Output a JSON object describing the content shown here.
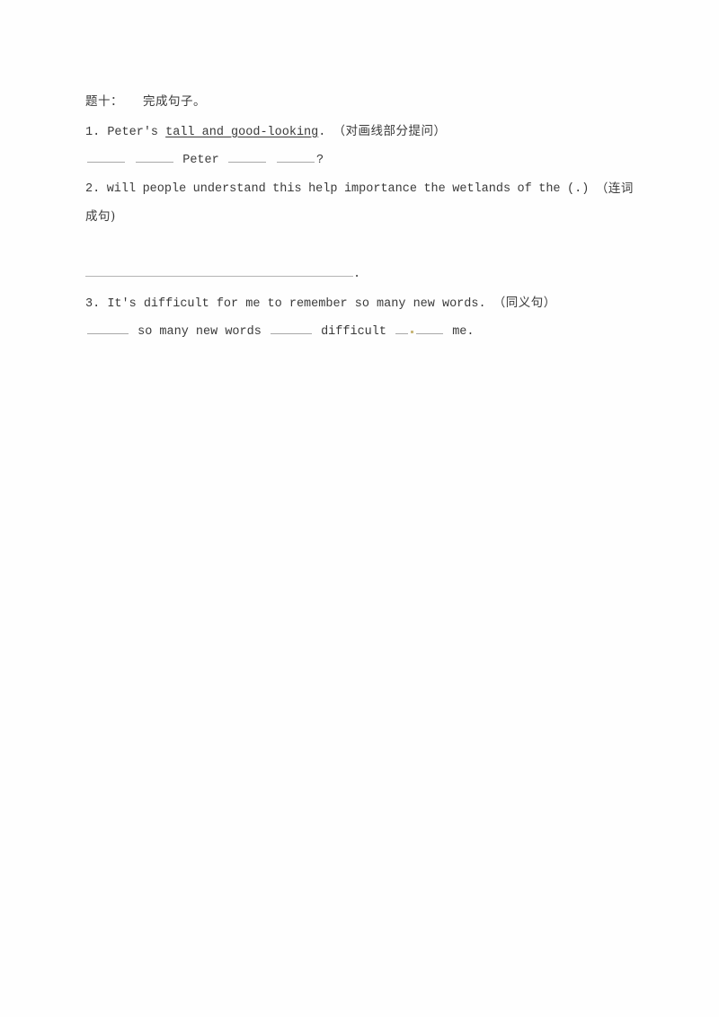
{
  "document": {
    "section_title": {
      "number_label": "题十：",
      "title_text": "完成句子。"
    },
    "questions": [
      {
        "index": "1.",
        "prefix": "Peter's ",
        "underlined": "tall and good-looking",
        "suffix": ".",
        "annotation": "（对画线部分提问）",
        "answer": {
          "middle_word": "Peter",
          "end_mark": "?"
        }
      },
      {
        "index": "2.",
        "scrambled_words": [
          "will",
          "people",
          "understand",
          "this",
          "help",
          "importance",
          "the",
          "wetlands",
          "of",
          "the",
          "(.)",
          "（连词"
        ],
        "annotation_continued": "成句)",
        "answer": {
          "end_mark": "."
        }
      },
      {
        "index": "3.",
        "sentence": "It's difficult for me to remember so many new words.",
        "annotation": "（同义句）",
        "answer": {
          "segment_1": "so many new words",
          "segment_2": "difficult",
          "segment_3": "me."
        }
      }
    ]
  }
}
